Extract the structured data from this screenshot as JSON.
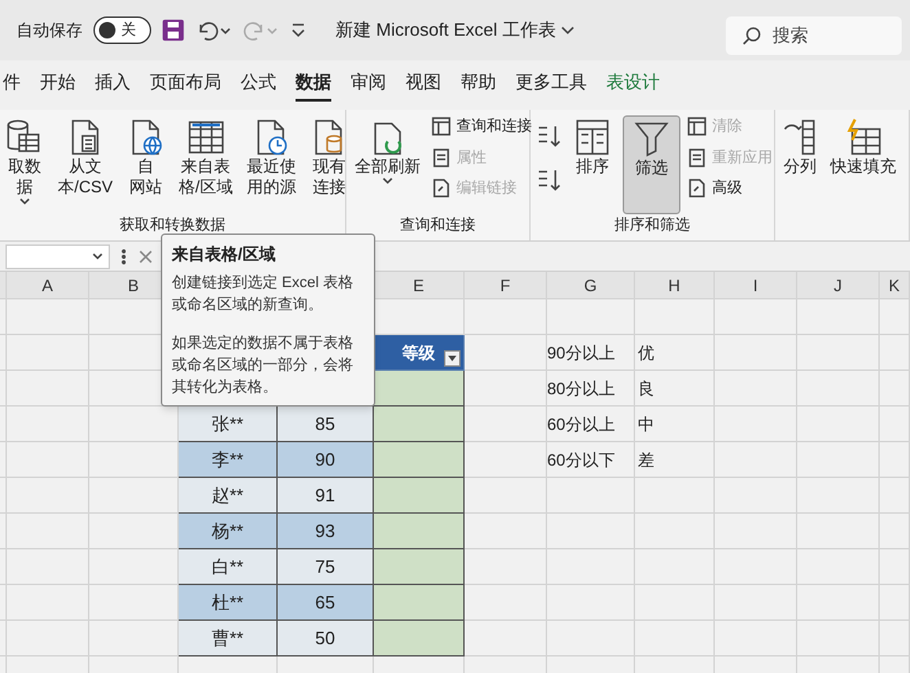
{
  "title_bar": {
    "autosave": {
      "label": "自动保存",
      "on": false,
      "state_label": "关"
    },
    "title": "新建 Microsoft Excel 工作表",
    "search": {
      "placeholder": "搜索"
    }
  },
  "tabs": [
    {
      "label": "件",
      "selected": false,
      "contextual": false
    },
    {
      "label": "开始",
      "selected": false,
      "contextual": false
    },
    {
      "label": "插入",
      "selected": false,
      "contextual": false
    },
    {
      "label": "页面布局",
      "selected": false,
      "contextual": false
    },
    {
      "label": "公式",
      "selected": false,
      "contextual": false
    },
    {
      "label": "数据",
      "selected": true,
      "contextual": false
    },
    {
      "label": "审阅",
      "selected": false,
      "contextual": false
    },
    {
      "label": "视图",
      "selected": false,
      "contextual": false
    },
    {
      "label": "帮助",
      "selected": false,
      "contextual": false
    },
    {
      "label": "更多工具",
      "selected": false,
      "contextual": false
    },
    {
      "label": "表设计",
      "selected": false,
      "contextual": true
    }
  ],
  "ribbon": {
    "groups": [
      {
        "label": "获取和转换数据",
        "buttons": [
          {
            "kind": "large",
            "lines": [
              "取数",
              "据"
            ],
            "caret": true,
            "disabled": false,
            "selected": false
          },
          {
            "kind": "large",
            "lines": [
              "从文",
              "本/CSV"
            ],
            "caret": false,
            "disabled": false,
            "selected": false
          },
          {
            "kind": "large",
            "lines": [
              "自",
              "网站"
            ],
            "caret": false,
            "disabled": false,
            "selected": false
          },
          {
            "kind": "large",
            "lines": [
              "来自表",
              "格/区域"
            ],
            "caret": false,
            "disabled": false,
            "selected": false
          },
          {
            "kind": "large",
            "lines": [
              "最近使",
              "用的源"
            ],
            "caret": false,
            "disabled": false,
            "selected": false
          },
          {
            "kind": "large",
            "lines": [
              "现有",
              "连接"
            ],
            "caret": false,
            "disabled": false,
            "selected": false
          }
        ]
      },
      {
        "label": "查询和连接",
        "buttons": [
          {
            "kind": "large",
            "lines": [
              "全部刷新"
            ],
            "caret": true,
            "disabled": false,
            "selected": false
          },
          {
            "kind": "stack",
            "items": [
              {
                "label": "查询和连接",
                "disabled": false
              },
              {
                "label": "属性",
                "disabled": true
              },
              {
                "label": "编辑链接",
                "disabled": true
              }
            ]
          }
        ]
      },
      {
        "label": "排序和筛选",
        "buttons": [
          {
            "kind": "iconstack"
          },
          {
            "kind": "large",
            "lines": [
              "排序"
            ],
            "caret": false,
            "disabled": false,
            "selected": false
          },
          {
            "kind": "large",
            "lines": [
              "筛选"
            ],
            "caret": false,
            "disabled": false,
            "selected": true
          },
          {
            "kind": "stack",
            "items": [
              {
                "label": "清除",
                "disabled": true
              },
              {
                "label": "重新应用",
                "disabled": true
              },
              {
                "label": "高级",
                "disabled": false
              }
            ]
          }
        ]
      },
      {
        "buttons": [
          {
            "kind": "large",
            "lines": [
              "分列"
            ],
            "caret": false,
            "disabled": false,
            "selected": false
          },
          {
            "kind": "large",
            "lines": [
              "快速填充"
            ],
            "caret": false,
            "disabled": false,
            "selected": false
          }
        ]
      }
    ]
  },
  "tooltip": {
    "title": "来自表格/区域",
    "paragraphs": [
      "创建链接到选定 Excel 表格或命名区域的新查询。",
      "如果选定的数据不属于表格或命名区域的一部分，会将其转化为表格。"
    ]
  },
  "column_headers": [
    "A",
    "B",
    "E",
    "F",
    "G",
    "H",
    "I",
    "J",
    "K"
  ],
  "score_table": {
    "grade_header": "等级",
    "rows": [
      {
        "name": "张**",
        "score": "85"
      },
      {
        "name": "李**",
        "score": "90"
      },
      {
        "name": "赵**",
        "score": "91"
      },
      {
        "name": "杨**",
        "score": "93"
      },
      {
        "name": "白**",
        "score": "75"
      },
      {
        "name": "杜**",
        "score": "65"
      },
      {
        "name": "曹**",
        "score": "50"
      }
    ]
  },
  "grade_rules": [
    {
      "range": "90分以上",
      "grade": "优"
    },
    {
      "range": "80分以上",
      "grade": "良"
    },
    {
      "range": "60分以上",
      "grade": "中"
    },
    {
      "range": "60分以下",
      "grade": "差"
    }
  ]
}
